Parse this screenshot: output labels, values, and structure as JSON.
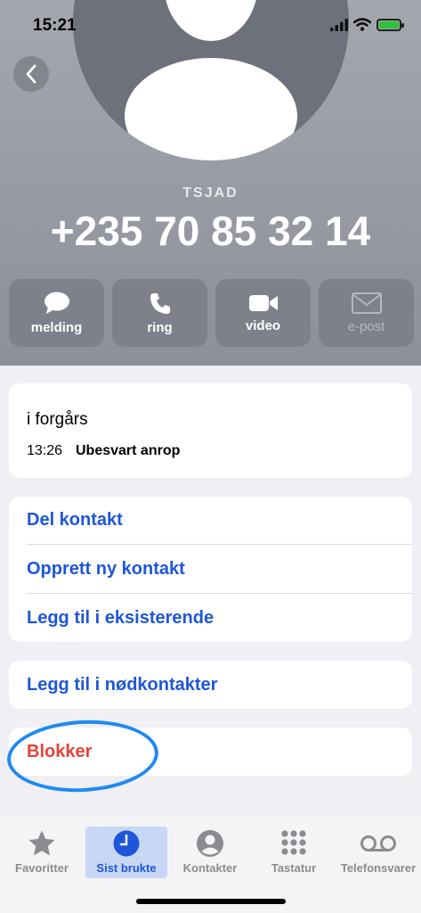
{
  "status_bar": {
    "time": "15:21"
  },
  "contact": {
    "label": "TSJAD",
    "number": "+235 70 85 32 14"
  },
  "actions": [
    {
      "label": "melding",
      "icon": "message-icon",
      "enabled": true
    },
    {
      "label": "ring",
      "icon": "phone-icon",
      "enabled": true
    },
    {
      "label": "video",
      "icon": "video-icon",
      "enabled": true
    },
    {
      "label": "e-post",
      "icon": "mail-icon",
      "enabled": false
    }
  ],
  "recent": {
    "day": "i forgårs",
    "time": "13:26",
    "status": "Ubesvart anrop"
  },
  "options": {
    "share": "Del kontakt",
    "create": "Opprett ny kontakt",
    "add_existing": "Legg til i eksisterende",
    "emergency": "Legg til i nødkontakter",
    "block": "Blokker"
  },
  "tabs": [
    {
      "label": "Favoritter",
      "icon": "star-icon",
      "active": false
    },
    {
      "label": "Sist brukte",
      "icon": "clock-icon",
      "active": true
    },
    {
      "label": "Kontakter",
      "icon": "person-icon",
      "active": false
    },
    {
      "label": "Tastatur",
      "icon": "keypad-icon",
      "active": false
    },
    {
      "label": "Telefonsvarer",
      "icon": "voicemail-icon",
      "active": false
    }
  ],
  "colors": {
    "accent": "#1d56d9",
    "destructive": "#e4433a",
    "battery": "#30c13b",
    "annotation": "#1e8af0"
  }
}
